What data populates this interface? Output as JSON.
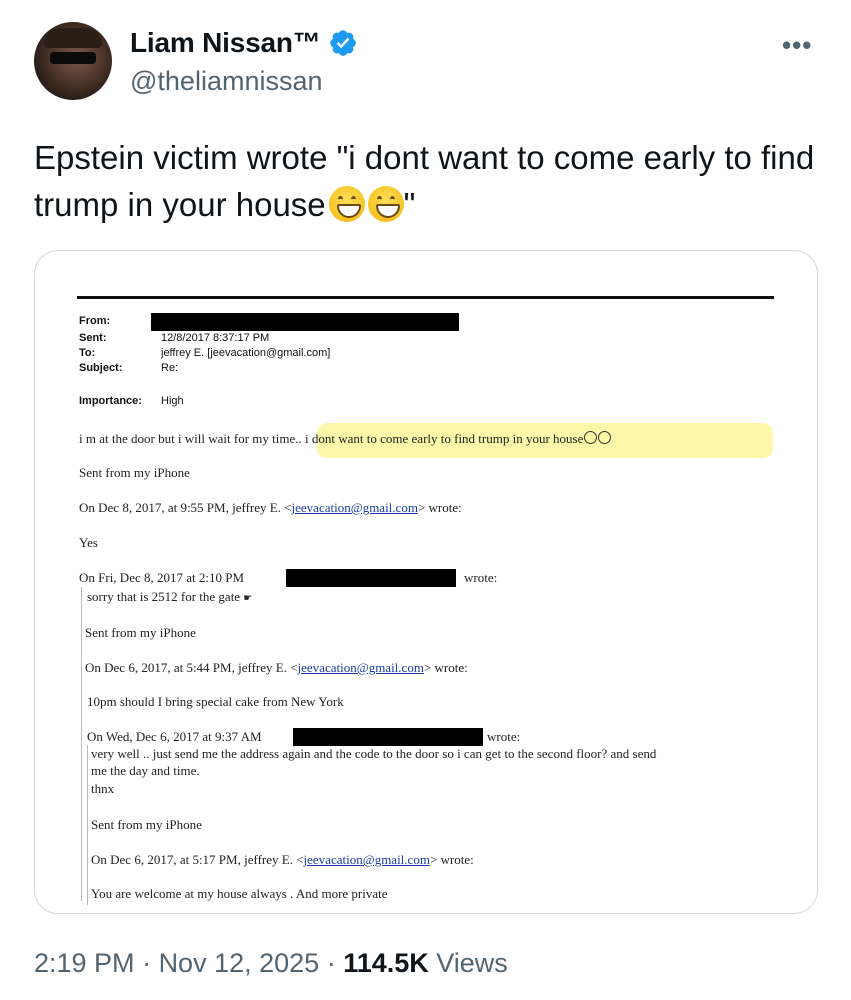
{
  "author": {
    "name": "Liam Nissan™",
    "handle": "@theliamnissan",
    "verified": true
  },
  "more_icon": "more-horizontal-icon",
  "tweet": {
    "text_before": "Epstein victim wrote \"i dont want to come early to find trump in your house",
    "emoji": "grinning-face-with-smiling-eyes",
    "text_after": "\""
  },
  "email": {
    "labels": {
      "from": "From:",
      "sent": "Sent:",
      "to": "To:",
      "subject": "Subject:",
      "importance": "Importance:"
    },
    "sent_value": "12/8/2017 8:37:17 PM",
    "to_value": "jeffrey E. [jeevacation@gmail.com]",
    "subject_value": "Re:",
    "importance_value": "High",
    "body_first": "i m at the door but i will wait for my time.. i dont want to come early to find trump in your house",
    "sent_iphone_1": "Sent from my iPhone",
    "quote1_prefix": "On Dec 8, 2017, at 9:55 PM, jeffrey E. <",
    "quote1_link": "jeevacation@gmail.com",
    "quote1_suffix": "> wrote:",
    "yes": "Yes",
    "quote2_prefix": "On Fri, Dec 8, 2017 at 2:10 PM",
    "quote2_suffix": "wrote:",
    "gate_line": "sorry that is 2512 for the gate",
    "sent_iphone_2": "Sent from my iPhone",
    "quote3_prefix": "On Dec 6, 2017, at 5:44 PM, jeffrey E. <",
    "quote3_link": "jeevacation@gmail.com",
    "quote3_suffix": "> wrote:",
    "cake_line": "10pm should I bring special cake from New York",
    "quote4_prefix": "On Wed, Dec 6, 2017 at 9:37 AM",
    "quote4_suffix": "wrote:",
    "very_well_1": "very well .. just send me the address again and the code to the door so i can get to the second floor? and send",
    "very_well_2": "me the day and time.",
    "thnx": "thnx",
    "sent_iphone_3": "Sent from my iPhone",
    "quote5_prefix": "On Dec 6, 2017, at 5:17 PM, jeffrey E. <",
    "quote5_link": "jeevacation@gmail.com",
    "quote5_suffix": "> wrote:",
    "welcome_line": "You are welcome at my house always . And more private"
  },
  "meta": {
    "time": "2:19 PM",
    "sep1": " · ",
    "date": "Nov 12, 2025",
    "sep2": " · ",
    "views_count": "114.5K",
    "views_label": " Views"
  },
  "colors": {
    "verified": "#1d9bf0",
    "secondary_text": "#536471",
    "highlight": "#fbf69a"
  }
}
